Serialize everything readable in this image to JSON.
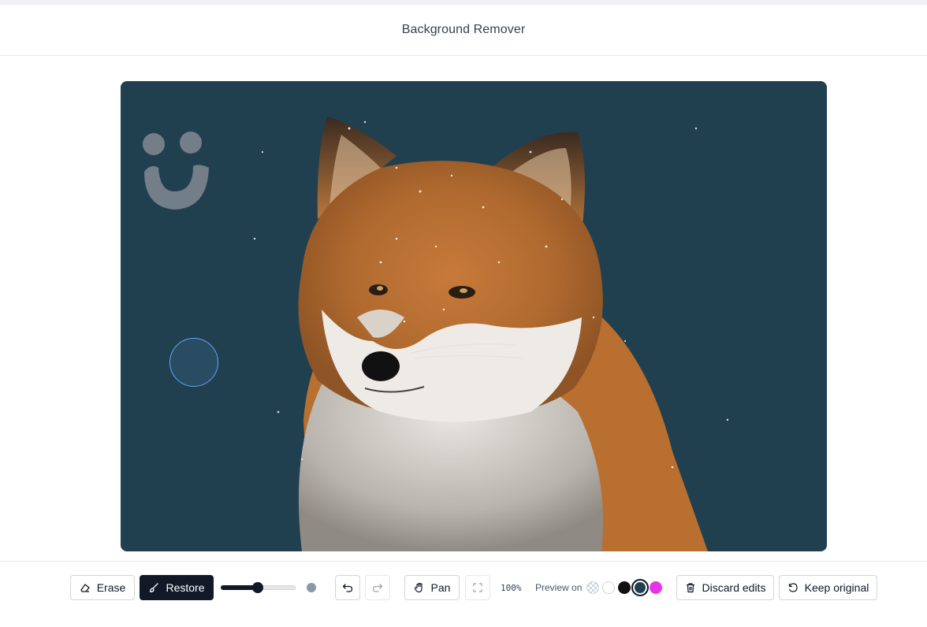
{
  "header": {
    "title": "Background Remover"
  },
  "canvas": {
    "background_color": "#21404f",
    "subject": "fox",
    "logo": "smiley-logo-icon"
  },
  "toolbar": {
    "erase_label": "Erase",
    "restore_label": "Restore",
    "active_tool": "Restore",
    "brush_size_fraction": 0.49,
    "undo_icon": "undo-icon",
    "redo_icon": "redo-icon",
    "pan_label": "Pan",
    "fit_icon": "fit-screen-icon",
    "zoom_text": "100%",
    "preview_label": "Preview on",
    "preview_swatches": [
      {
        "name": "transparent",
        "color": "checker"
      },
      {
        "name": "white",
        "color": "#ffffff"
      },
      {
        "name": "black",
        "color": "#111111"
      },
      {
        "name": "dark-teal",
        "color": "#21404f",
        "selected": true
      },
      {
        "name": "magenta",
        "color": "#e635e6"
      }
    ],
    "discard_label": "Discard edits",
    "keep_label": "Keep original"
  },
  "colors": {
    "accent": "#111827",
    "canvas_bg": "#21404f",
    "brush_ring": "#60a5fa"
  }
}
